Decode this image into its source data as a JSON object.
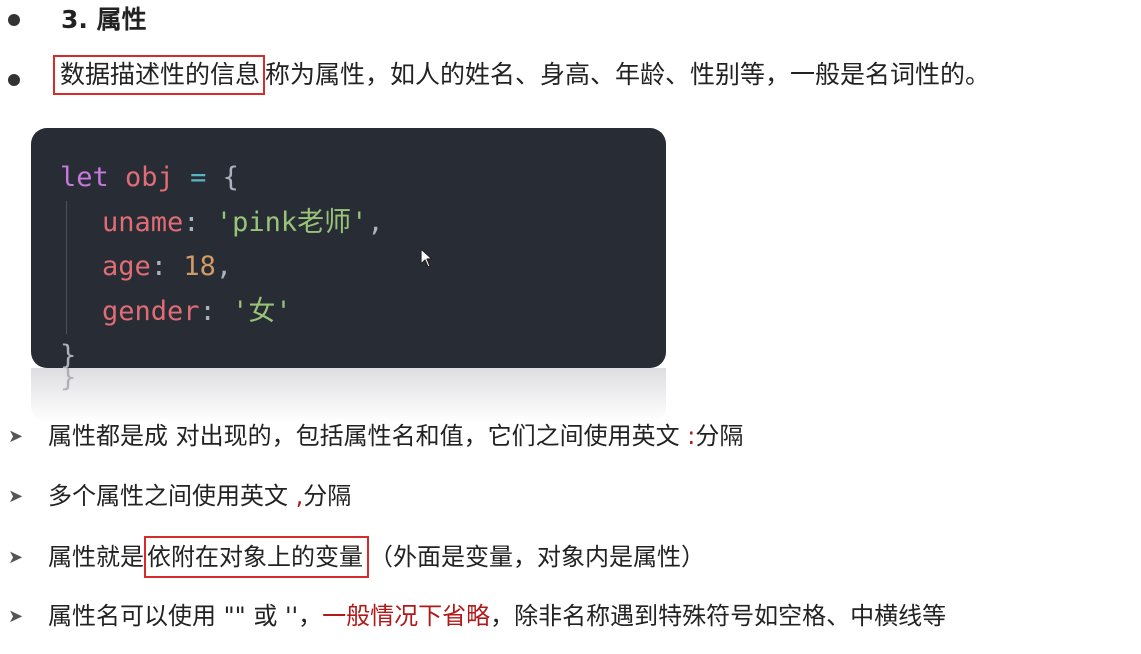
{
  "heading": "3. 属性",
  "intro": {
    "boxed": "数据描述性的信息",
    "rest": "称为属性，如人的姓名、身高、年龄、性别等，一般是名词性的。"
  },
  "code": {
    "line1": {
      "kw": "let",
      "var": "obj",
      "op": "=",
      "brace": "{"
    },
    "line2": {
      "prop": "uname",
      "colon": ":",
      "str": "'pink老师'",
      "comma": ","
    },
    "line3": {
      "prop": "age",
      "colon": ":",
      "num": "18",
      "comma": ","
    },
    "line4": {
      "prop": "gender",
      "colon": ":",
      "str": "'女'"
    },
    "line5": {
      "brace": "}"
    },
    "ghost": "}"
  },
  "points": [
    {
      "before": "属性都是成 对出现的，包括属性名和值，它们之间使用英文 ",
      "red": ":",
      "after": "分隔"
    },
    {
      "before": "多个属性之间使用英文 ",
      "red": ",",
      "after": "分隔"
    },
    {
      "before": "属性就是",
      "boxed": "依附在对象上的变量",
      "after": "（外面是变量，对象内是属性）"
    },
    {
      "before": "属性名可以使用 \"\" 或 ''，",
      "red": "一般情况下省略",
      "after": "，除非名称遇到特殊符号如空格、中横线等"
    }
  ],
  "colors": {
    "code_bg": "#282c34",
    "keyword": "#c678dd",
    "property": "#e06c75",
    "string": "#98c379",
    "number": "#d19a66",
    "highlight_red": "#b01a1a",
    "box_border": "#d62b2b"
  },
  "icons": {
    "bullet": "filled-circle",
    "point": "arrowhead-right",
    "cursor": "mouse-pointer"
  }
}
